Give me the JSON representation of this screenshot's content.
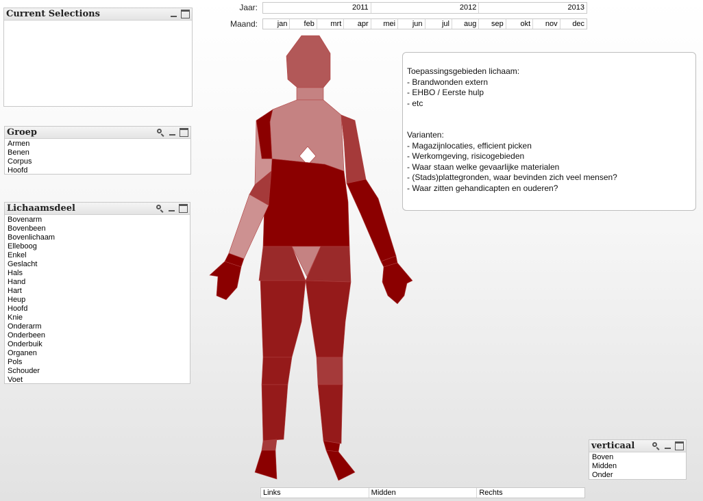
{
  "current_selections": {
    "title": "Current Selections"
  },
  "groep": {
    "title": "Groep",
    "items": [
      "Armen",
      "Benen",
      "Corpus",
      "Hoofd"
    ]
  },
  "lichaamsdeel": {
    "title": "Lichaamsdeel",
    "items": [
      "Bovenarm",
      "Bovenbeen",
      "Bovenlichaam",
      "Elleboog",
      "Enkel",
      "Geslacht",
      "Hals",
      "Hand",
      "Hart",
      "Heup",
      "Hoofd",
      "Knie",
      "Onderarm",
      "Onderbeen",
      "Onderbuik",
      "Organen",
      "Pols",
      "Schouder",
      "Voet"
    ]
  },
  "jaar": {
    "label": "Jaar:",
    "values": [
      "2011",
      "2012",
      "2013"
    ]
  },
  "maand": {
    "label": "Maand:",
    "values": [
      "jan",
      "feb",
      "mrt",
      "apr",
      "mei",
      "jun",
      "jul",
      "aug",
      "sep",
      "okt",
      "nov",
      "dec"
    ]
  },
  "info_text": {
    "lines": [
      "Toepassingsgebieden lichaam:",
      "- Brandwonden extern",
      "- EHBO / Eerste hulp",
      "- etc",
      "",
      "",
      "Varianten:",
      "- Magazijnlocaties, efficient picken",
      "- Werkomgeving, risicogebieden",
      "- Waar staan welke gevaarlijke materialen",
      "- (Stads)plattegronden, waar bevinden zich veel mensen?",
      "- Waar zitten gehandicapten en ouderen?"
    ]
  },
  "verticaal": {
    "title": "verticaal",
    "items": [
      "Boven",
      "Midden",
      "Onder"
    ]
  },
  "horizontaal": {
    "values": [
      "Links",
      "Midden",
      "Rechts"
    ]
  },
  "colors": {
    "dark": "#8b0000",
    "dark2": "#951a1a",
    "medium": "#9a2a2a",
    "medium2": "#a53a3a",
    "head": "#b25858",
    "light": "#c58282",
    "lighter": "#cd9191",
    "lightest": "#d8aaaa",
    "white": "#ffffff"
  }
}
